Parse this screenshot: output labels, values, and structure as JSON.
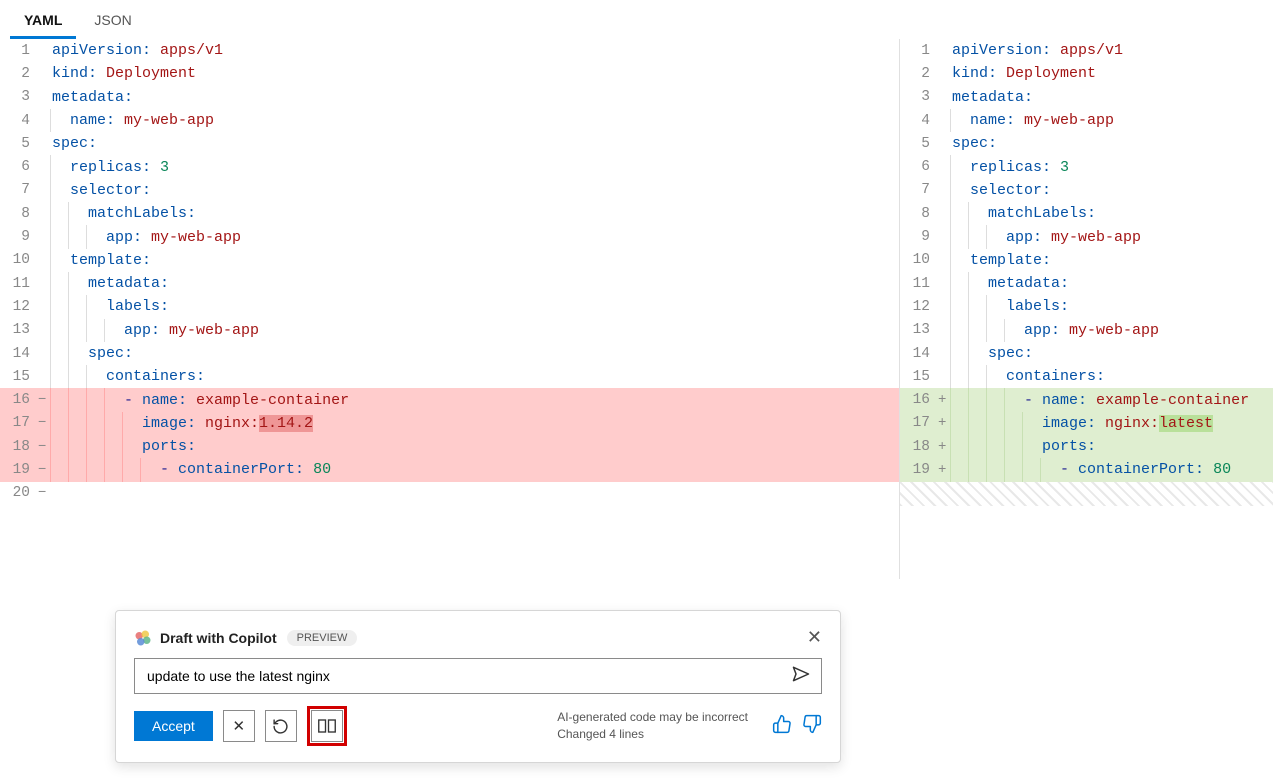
{
  "tabs": [
    {
      "label": "YAML",
      "active": true
    },
    {
      "label": "JSON",
      "active": false
    }
  ],
  "left": {
    "lines": [
      {
        "n": 1,
        "mark": "",
        "cls": "",
        "ind": 0,
        "tokens": [
          [
            "k",
            "apiVersion:"
          ],
          [
            "p",
            " "
          ],
          [
            "v",
            "apps/v1"
          ]
        ]
      },
      {
        "n": 2,
        "mark": "",
        "cls": "",
        "ind": 0,
        "tokens": [
          [
            "k",
            "kind:"
          ],
          [
            "p",
            " "
          ],
          [
            "v",
            "Deployment"
          ]
        ]
      },
      {
        "n": 3,
        "mark": "",
        "cls": "",
        "ind": 0,
        "tokens": [
          [
            "k",
            "metadata:"
          ]
        ]
      },
      {
        "n": 4,
        "mark": "",
        "cls": "",
        "ind": 1,
        "tokens": [
          [
            "k",
            "name:"
          ],
          [
            "p",
            " "
          ],
          [
            "v",
            "my-web-app"
          ]
        ]
      },
      {
        "n": 5,
        "mark": "",
        "cls": "",
        "ind": 0,
        "tokens": [
          [
            "k",
            "spec:"
          ]
        ]
      },
      {
        "n": 6,
        "mark": "",
        "cls": "",
        "ind": 1,
        "tokens": [
          [
            "k",
            "replicas:"
          ],
          [
            "p",
            " "
          ],
          [
            "n",
            "3"
          ]
        ]
      },
      {
        "n": 7,
        "mark": "",
        "cls": "",
        "ind": 1,
        "tokens": [
          [
            "k",
            "selector:"
          ]
        ]
      },
      {
        "n": 8,
        "mark": "",
        "cls": "",
        "ind": 2,
        "tokens": [
          [
            "k",
            "matchLabels:"
          ]
        ]
      },
      {
        "n": 9,
        "mark": "",
        "cls": "",
        "ind": 3,
        "tokens": [
          [
            "k",
            "app:"
          ],
          [
            "p",
            " "
          ],
          [
            "v",
            "my-web-app"
          ]
        ]
      },
      {
        "n": 10,
        "mark": "",
        "cls": "",
        "ind": 1,
        "tokens": [
          [
            "k",
            "template:"
          ]
        ]
      },
      {
        "n": 11,
        "mark": "",
        "cls": "",
        "ind": 2,
        "tokens": [
          [
            "k",
            "metadata:"
          ]
        ]
      },
      {
        "n": 12,
        "mark": "",
        "cls": "",
        "ind": 3,
        "tokens": [
          [
            "k",
            "labels:"
          ]
        ]
      },
      {
        "n": 13,
        "mark": "",
        "cls": "",
        "ind": 4,
        "tokens": [
          [
            "k",
            "app:"
          ],
          [
            "p",
            " "
          ],
          [
            "v",
            "my-web-app"
          ]
        ]
      },
      {
        "n": 14,
        "mark": "",
        "cls": "",
        "ind": 2,
        "tokens": [
          [
            "k",
            "spec:"
          ]
        ]
      },
      {
        "n": 15,
        "mark": "",
        "cls": "",
        "ind": 3,
        "tokens": [
          [
            "k",
            "containers:"
          ]
        ]
      },
      {
        "n": 16,
        "mark": "−",
        "cls": "rm",
        "ind": 4,
        "tokens": [
          [
            "p",
            "- "
          ],
          [
            "k",
            "name:"
          ],
          [
            "p",
            " "
          ],
          [
            "v",
            "example-container"
          ]
        ]
      },
      {
        "n": 17,
        "mark": "−",
        "cls": "rm",
        "ind": 5,
        "tokens": [
          [
            "k",
            "image:"
          ],
          [
            "p",
            " "
          ],
          [
            "v",
            "nginx:"
          ],
          [
            "vrm",
            "1.14.2"
          ]
        ]
      },
      {
        "n": 18,
        "mark": "−",
        "cls": "rm",
        "ind": 5,
        "tokens": [
          [
            "k",
            "ports:"
          ]
        ]
      },
      {
        "n": 19,
        "mark": "−",
        "cls": "rm",
        "ind": 6,
        "tokens": [
          [
            "p",
            "- "
          ],
          [
            "k",
            "containerPort:"
          ],
          [
            "p",
            " "
          ],
          [
            "n",
            "80"
          ]
        ]
      },
      {
        "n": 20,
        "mark": "−",
        "cls": "",
        "ind": 0,
        "tokens": []
      }
    ]
  },
  "right": {
    "lines": [
      {
        "n": 1,
        "mark": "",
        "cls": "",
        "ind": 0,
        "tokens": [
          [
            "k",
            "apiVersion:"
          ],
          [
            "p",
            " "
          ],
          [
            "v",
            "apps/v1"
          ]
        ]
      },
      {
        "n": 2,
        "mark": "",
        "cls": "",
        "ind": 0,
        "tokens": [
          [
            "k",
            "kind:"
          ],
          [
            "p",
            " "
          ],
          [
            "v",
            "Deployment"
          ]
        ]
      },
      {
        "n": 3,
        "mark": "",
        "cls": "",
        "ind": 0,
        "tokens": [
          [
            "k",
            "metadata:"
          ]
        ]
      },
      {
        "n": 4,
        "mark": "",
        "cls": "",
        "ind": 1,
        "tokens": [
          [
            "k",
            "name:"
          ],
          [
            "p",
            " "
          ],
          [
            "v",
            "my-web-app"
          ]
        ]
      },
      {
        "n": 5,
        "mark": "",
        "cls": "",
        "ind": 0,
        "tokens": [
          [
            "k",
            "spec:"
          ]
        ]
      },
      {
        "n": 6,
        "mark": "",
        "cls": "",
        "ind": 1,
        "tokens": [
          [
            "k",
            "replicas:"
          ],
          [
            "p",
            " "
          ],
          [
            "n",
            "3"
          ]
        ]
      },
      {
        "n": 7,
        "mark": "",
        "cls": "",
        "ind": 1,
        "tokens": [
          [
            "k",
            "selector:"
          ]
        ]
      },
      {
        "n": 8,
        "mark": "",
        "cls": "",
        "ind": 2,
        "tokens": [
          [
            "k",
            "matchLabels:"
          ]
        ]
      },
      {
        "n": 9,
        "mark": "",
        "cls": "",
        "ind": 3,
        "tokens": [
          [
            "k",
            "app:"
          ],
          [
            "p",
            " "
          ],
          [
            "v",
            "my-web-app"
          ]
        ]
      },
      {
        "n": 10,
        "mark": "",
        "cls": "",
        "ind": 1,
        "tokens": [
          [
            "k",
            "template:"
          ]
        ]
      },
      {
        "n": 11,
        "mark": "",
        "cls": "",
        "ind": 2,
        "tokens": [
          [
            "k",
            "metadata:"
          ]
        ]
      },
      {
        "n": 12,
        "mark": "",
        "cls": "",
        "ind": 3,
        "tokens": [
          [
            "k",
            "labels:"
          ]
        ]
      },
      {
        "n": 13,
        "mark": "",
        "cls": "",
        "ind": 4,
        "tokens": [
          [
            "k",
            "app:"
          ],
          [
            "p",
            " "
          ],
          [
            "v",
            "my-web-app"
          ]
        ]
      },
      {
        "n": 14,
        "mark": "",
        "cls": "",
        "ind": 2,
        "tokens": [
          [
            "k",
            "spec:"
          ]
        ]
      },
      {
        "n": 15,
        "mark": "",
        "cls": "",
        "ind": 3,
        "tokens": [
          [
            "k",
            "containers:"
          ]
        ]
      },
      {
        "n": 16,
        "mark": "+",
        "cls": "ad",
        "ind": 4,
        "tokens": [
          [
            "p",
            "- "
          ],
          [
            "k",
            "name:"
          ],
          [
            "p",
            " "
          ],
          [
            "v",
            "example-container"
          ]
        ]
      },
      {
        "n": 17,
        "mark": "+",
        "cls": "ad",
        "ind": 5,
        "tokens": [
          [
            "k",
            "image:"
          ],
          [
            "p",
            " "
          ],
          [
            "v",
            "nginx:"
          ],
          [
            "vad",
            "latest"
          ]
        ]
      },
      {
        "n": 18,
        "mark": "+",
        "cls": "ad",
        "ind": 5,
        "tokens": [
          [
            "k",
            "ports:"
          ]
        ]
      },
      {
        "n": 19,
        "mark": "+",
        "cls": "ad",
        "ind": 6,
        "tokens": [
          [
            "p",
            "- "
          ],
          [
            "k",
            "containerPort:"
          ],
          [
            "p",
            " "
          ],
          [
            "n",
            "80"
          ]
        ]
      }
    ]
  },
  "copilot": {
    "title": "Draft with Copilot",
    "badge": "PREVIEW",
    "input": "update to use the latest nginx",
    "accept": "Accept",
    "msg_line1": "AI-generated code may be incorrect",
    "msg_line2": "Changed 4 lines"
  }
}
